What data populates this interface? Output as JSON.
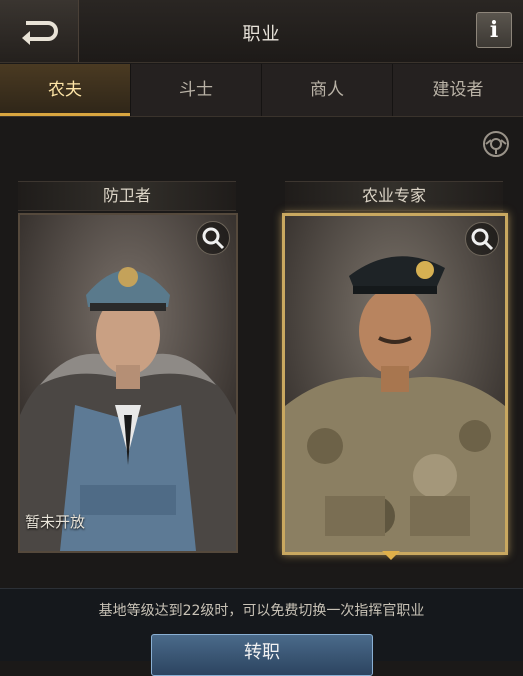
{
  "header": {
    "title": "职业",
    "info_label": "i"
  },
  "tabs": [
    {
      "label": "农夫",
      "active": true
    },
    {
      "label": "斗士",
      "active": false
    },
    {
      "label": "商人",
      "active": false
    },
    {
      "label": "建设者",
      "active": false
    }
  ],
  "cards": [
    {
      "title": "防卫者",
      "status": "暂未开放",
      "selected": false,
      "portrait": "officer-portrait"
    },
    {
      "title": "农业专家",
      "status": "",
      "selected": true,
      "portrait": "soldier-portrait"
    }
  ],
  "footer": {
    "notice": "基地等级达到22级时，可以免费切换一次指挥官职业",
    "action_label": "转职"
  },
  "colors": {
    "accent_gold": "#d9a53f",
    "button_blue": "#3d5a78"
  },
  "icons": [
    "back-arrow-icon",
    "info-icon",
    "settings-icon",
    "zoom-icon"
  ]
}
